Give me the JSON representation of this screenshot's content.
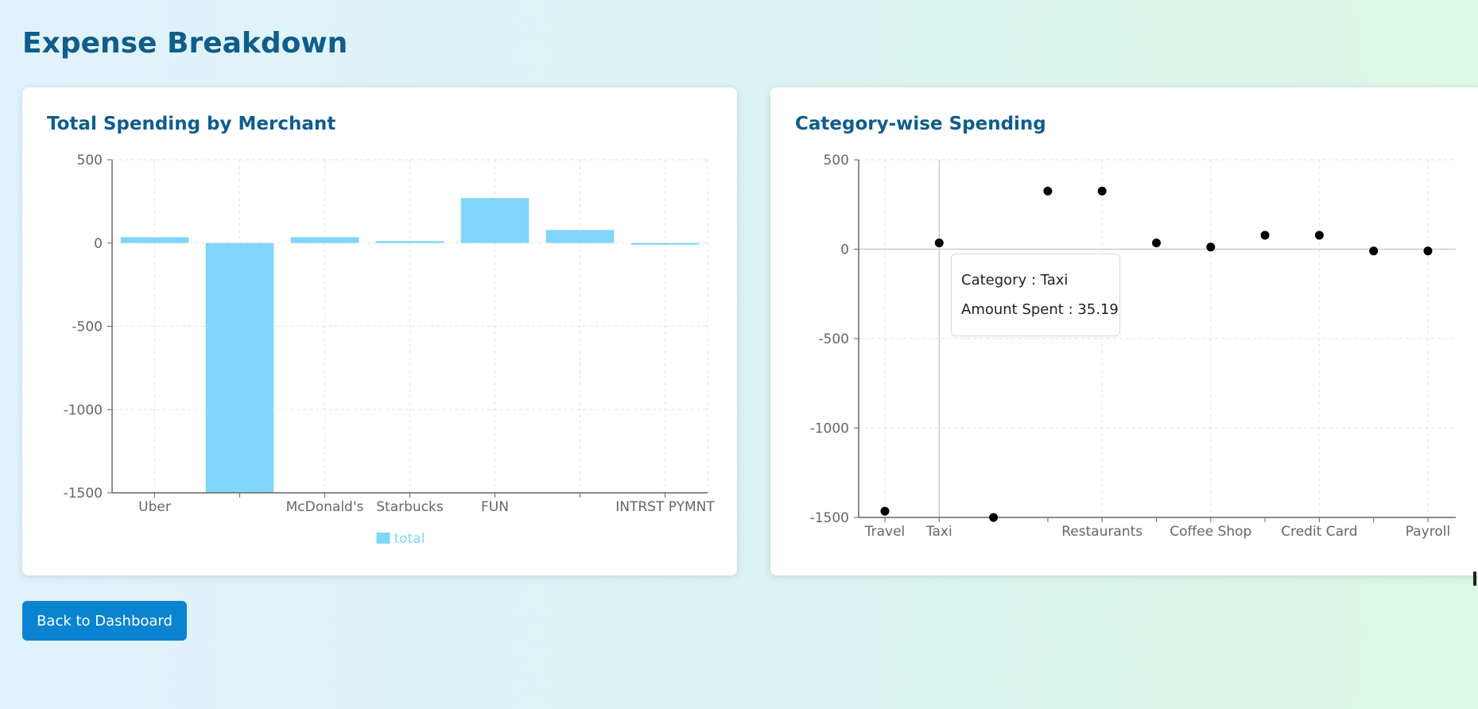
{
  "page": {
    "title": "Expense Breakdown"
  },
  "actions": {
    "back_label": "Back to Dashboard"
  },
  "colors": {
    "title": "#0e5d8c",
    "bar": "#81d4fa",
    "point": "#000000",
    "button": "#0a84d0"
  },
  "chart_data": [
    {
      "type": "bar",
      "title": "Total Spending by Merchant",
      "categories": [
        "Uber",
        "",
        "McDonald's",
        "Starbucks",
        "FUN",
        "",
        "INTRST PYMNT"
      ],
      "series": [
        {
          "name": "total",
          "values": [
            35,
            -1500,
            35,
            12,
            270,
            78,
            -10
          ]
        }
      ],
      "xlabel": "",
      "ylabel": "",
      "ylim": [
        -1500,
        500
      ],
      "yticks": [
        500,
        0,
        -500,
        -1000,
        -1500
      ],
      "grid": true,
      "legend": "bottom-center"
    },
    {
      "type": "scatter",
      "title": "Category-wise Spending",
      "categories": [
        "Travel",
        "Taxi",
        "",
        "",
        "Restaurants",
        "",
        "Coffee Shop",
        "",
        "Credit Card",
        "",
        "Payroll"
      ],
      "series": [
        {
          "values": [
            -1465,
            35.19,
            -1500,
            325,
            325,
            35,
            12,
            78,
            78,
            -10,
            -10
          ]
        }
      ],
      "xlabel": "",
      "ylabel": "",
      "ylim": [
        -1500,
        500
      ],
      "yticks": [
        500,
        0,
        -500,
        -1000,
        -1500
      ],
      "grid": true,
      "tooltip": {
        "category_line": "Category : Taxi",
        "amount_line": "Amount Spent : 35.19",
        "active_index": 1
      }
    }
  ]
}
